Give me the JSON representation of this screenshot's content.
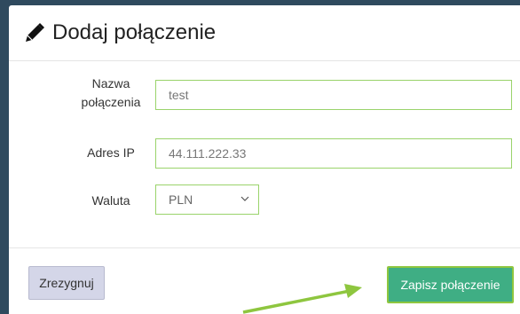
{
  "modal": {
    "title": "Dodaj połączenie",
    "title_icon": "pencil-icon"
  },
  "form": {
    "name_label_line1": "Nazwa",
    "name_label_line2": "połączenia",
    "name_value": "test",
    "ip_label": "Adres IP",
    "ip_value": "44.111.222.33",
    "currency_label": "Waluta",
    "currency_selected": "PLN"
  },
  "footer": {
    "cancel_label": "Zrezygnuj",
    "save_label": "Zapisz połączenie"
  },
  "colors": {
    "backdrop": "#2f4a5e",
    "input_border": "#9ad36b",
    "save_button": "#3fae84",
    "annotation_arrow": "#8ec63f"
  }
}
